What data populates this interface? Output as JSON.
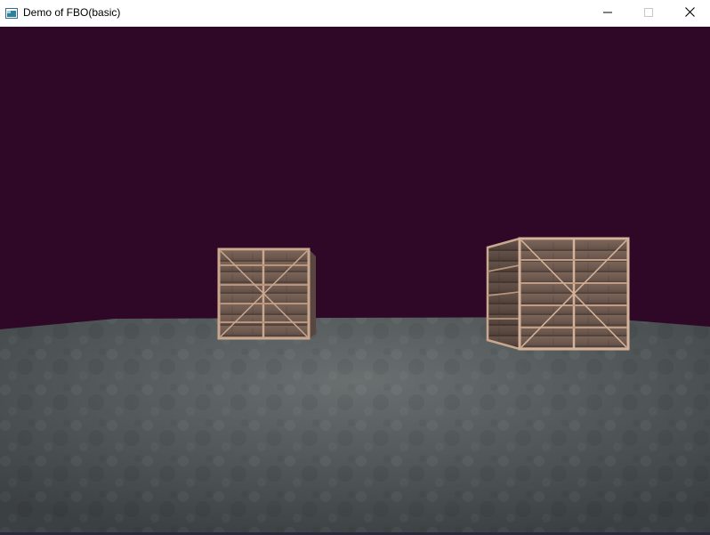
{
  "window": {
    "title": "Demo of FBO(basic)",
    "controls": {
      "minimize_icon": "minimize-icon",
      "maximize_icon": "maximize-icon",
      "close_icon": "close-icon"
    }
  },
  "scene": {
    "sky_color": "#2e0826",
    "floor_color": "#4a4f50",
    "crate_color": "#8a6a58",
    "crate_count": 2
  }
}
